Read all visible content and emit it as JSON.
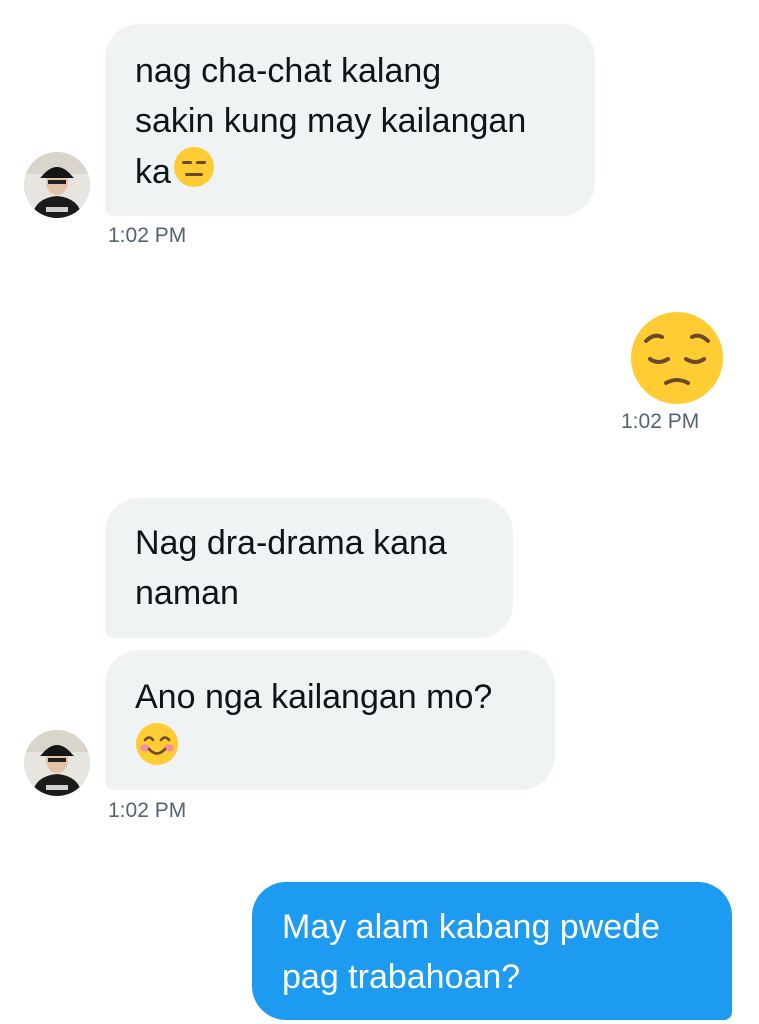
{
  "messages": [
    {
      "direction": "incoming",
      "lines": [
        "nag cha-chat kalang",
        "sakin kung may kailangan",
        "ka"
      ],
      "trailing_emoji": "expressionless-face",
      "time": "1:02 PM"
    },
    {
      "direction": "outgoing",
      "emoji": "pensive-face",
      "time": "1:02 PM"
    },
    {
      "direction": "incoming",
      "lines": [
        "Nag dra-drama kana",
        "naman"
      ]
    },
    {
      "direction": "incoming",
      "lines": [
        "Ano nga kailangan mo?"
      ],
      "trailing_emoji": "smiling-face-with-smiling-eyes",
      "time": "1:02 PM"
    },
    {
      "direction": "outgoing",
      "lines": [
        "May alam kabang pwede",
        "pag trabahoan?"
      ]
    }
  ],
  "colors": {
    "incoming_bubble": "#eff3f4",
    "outgoing_bubble": "#1d9bf0",
    "timestamp": "#536471",
    "emoji_yellow": "#ffcc33"
  }
}
